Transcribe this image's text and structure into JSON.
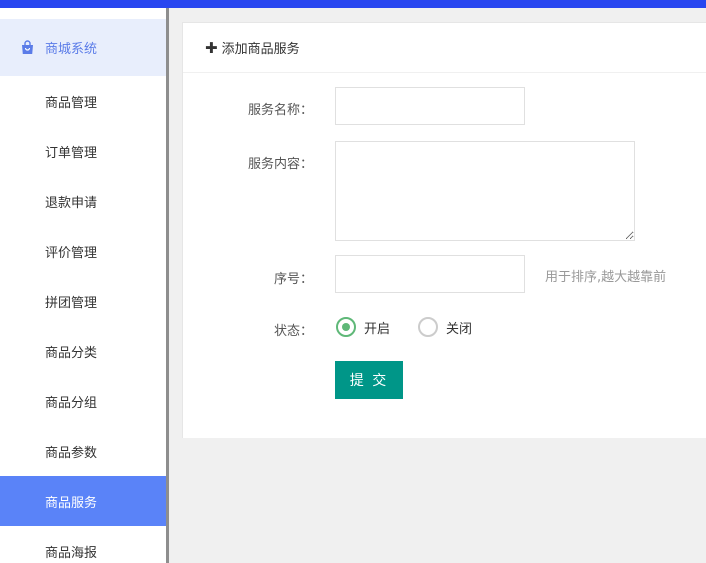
{
  "sidebar": {
    "header": {
      "label": "商城系统",
      "icon": "shopping-bag-icon",
      "color": "#5b7ce8"
    },
    "items": [
      {
        "label": "商品管理",
        "active": false
      },
      {
        "label": "订单管理",
        "active": false
      },
      {
        "label": "退款申请",
        "active": false
      },
      {
        "label": "评价管理",
        "active": false
      },
      {
        "label": "拼团管理",
        "active": false
      },
      {
        "label": "商品分类",
        "active": false
      },
      {
        "label": "商品分组",
        "active": false
      },
      {
        "label": "商品参数",
        "active": false
      },
      {
        "label": "商品服务",
        "active": true
      },
      {
        "label": "商品海报",
        "active": false
      }
    ],
    "active_color": "#5a83f8"
  },
  "form": {
    "title": "添加商品服务",
    "title_icon": "plus-icon",
    "service_name_label": "服务名称：",
    "service_name_value": "",
    "service_content_label": "服务内容：",
    "service_content_value": "",
    "order_label": "序号：",
    "order_value": "",
    "order_hint": "用于排序,越大越靠前",
    "status_label": "状态：",
    "status_options": [
      {
        "label": "开启",
        "checked": true
      },
      {
        "label": "关闭",
        "checked": false
      }
    ],
    "submit_label": "提 交"
  },
  "colors": {
    "topbar": "#2846f0",
    "submit": "#009688",
    "radio_checked": "#5fb878"
  }
}
